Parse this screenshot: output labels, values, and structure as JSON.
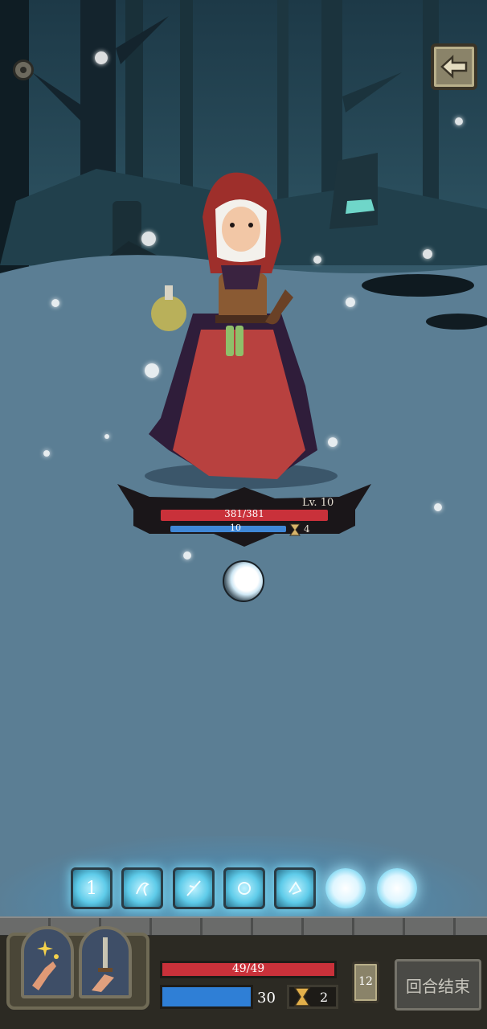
{
  "enemy": {
    "level": "Lv. 10",
    "hp": "381/381",
    "mana": "10",
    "turns": "4"
  },
  "energy_cards": [
    "1"
  ],
  "player": {
    "hp": "49/49",
    "mana": "30",
    "turn": "2",
    "deck_count": "12"
  },
  "end_turn_label": "回合结束",
  "colors": {
    "hp": "#c9313a",
    "mana": "#3f87d6",
    "glow": "#7fe3ff"
  }
}
